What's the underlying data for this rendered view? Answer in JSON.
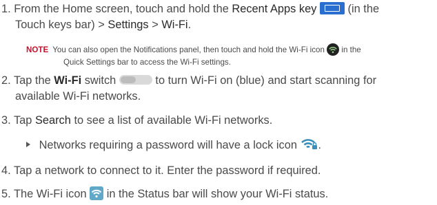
{
  "steps": [
    {
      "number": "1.",
      "part_a": "From the Home screen, touch and hold the",
      "recent_apps": "Recent Apps key",
      "part_b": "(in the",
      "part_c": "Touch keys bar) >",
      "settings": "Settings",
      "sep": ">",
      "wifi": "Wi-Fi",
      "period": "."
    },
    {
      "number": "2.",
      "part_a": "Tap the",
      "wifi": "Wi-Fi",
      "switch_word": "switch",
      "part_b": "to turn Wi-Fi on (blue) and start scanning for",
      "part_c": "available Wi-Fi networks."
    },
    {
      "number": "3.",
      "part_a": "Tap",
      "search": "Search",
      "part_b": "to see a list of available Wi-Fi networks."
    },
    {
      "number": "4.",
      "text": "Tap a network to connect to it. Enter the password if required."
    },
    {
      "number": "5.",
      "part_a": "The Wi-Fi icon",
      "part_b": "in the Status bar will show your Wi-Fi status."
    }
  ],
  "note": {
    "label": "NOTE",
    "part_a": "You can also open the Notifications panel, then touch and hold the Wi-Fi icon",
    "part_b": "in the",
    "part_c": "Quick Settings bar to access the Wi-Fi settings."
  },
  "bullet": {
    "text": "Networks requiring a password will have a lock icon",
    "end": "."
  },
  "icons": {
    "recent_apps": "recent-apps-key-icon",
    "quick_settings_wifi": "wifi-circle-icon",
    "switch": "wifi-switch-icon",
    "lock_wifi": "locked-wifi-icon",
    "status_wifi": "status-bar-wifi-icon"
  },
  "colors": {
    "note_label": "#c8102e",
    "recent_apps_key": "#2a6fcf",
    "status_wifi": "#5fa8c8",
    "lock_wifi": "#3a8fb8"
  }
}
